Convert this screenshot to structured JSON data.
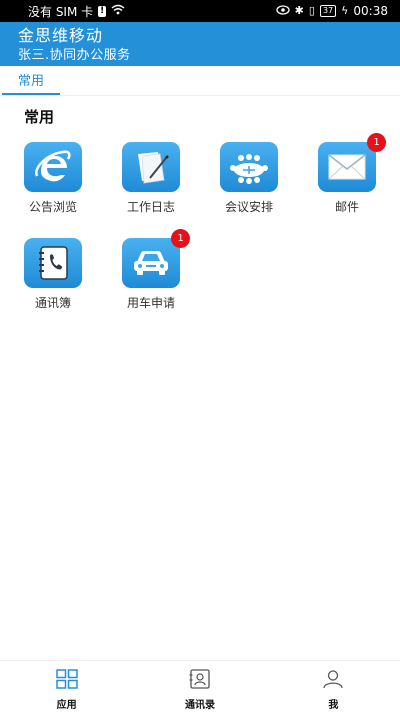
{
  "status_bar": {
    "carrier": "没有 SIM 卡",
    "battery": "37",
    "time": "00:38"
  },
  "header": {
    "title": "金思维移动",
    "subtitle": "张三.协同办公服务",
    "background_color": "#2390d8"
  },
  "tabs": [
    {
      "label": "常用",
      "active": true
    }
  ],
  "section": {
    "title": "常用"
  },
  "apps": [
    {
      "label": "公告浏览",
      "icon": "ie-icon",
      "badge": null
    },
    {
      "label": "工作日志",
      "icon": "notepad-icon",
      "badge": null
    },
    {
      "label": "会议安排",
      "icon": "meeting-icon",
      "badge": null
    },
    {
      "label": "邮件",
      "icon": "envelope-icon",
      "badge": "1"
    },
    {
      "label": "通讯簿",
      "icon": "phonebook-icon",
      "badge": null
    },
    {
      "label": "用车申请",
      "icon": "car-icon",
      "badge": "1"
    }
  ],
  "bottom_nav": [
    {
      "label": "应用",
      "icon": "grid-icon",
      "active": true
    },
    {
      "label": "通讯录",
      "icon": "contacts-icon",
      "active": false
    },
    {
      "label": "我",
      "icon": "person-icon",
      "active": false
    }
  ],
  "colors": {
    "accent": "#2390d8",
    "badge": "#e8101a"
  }
}
